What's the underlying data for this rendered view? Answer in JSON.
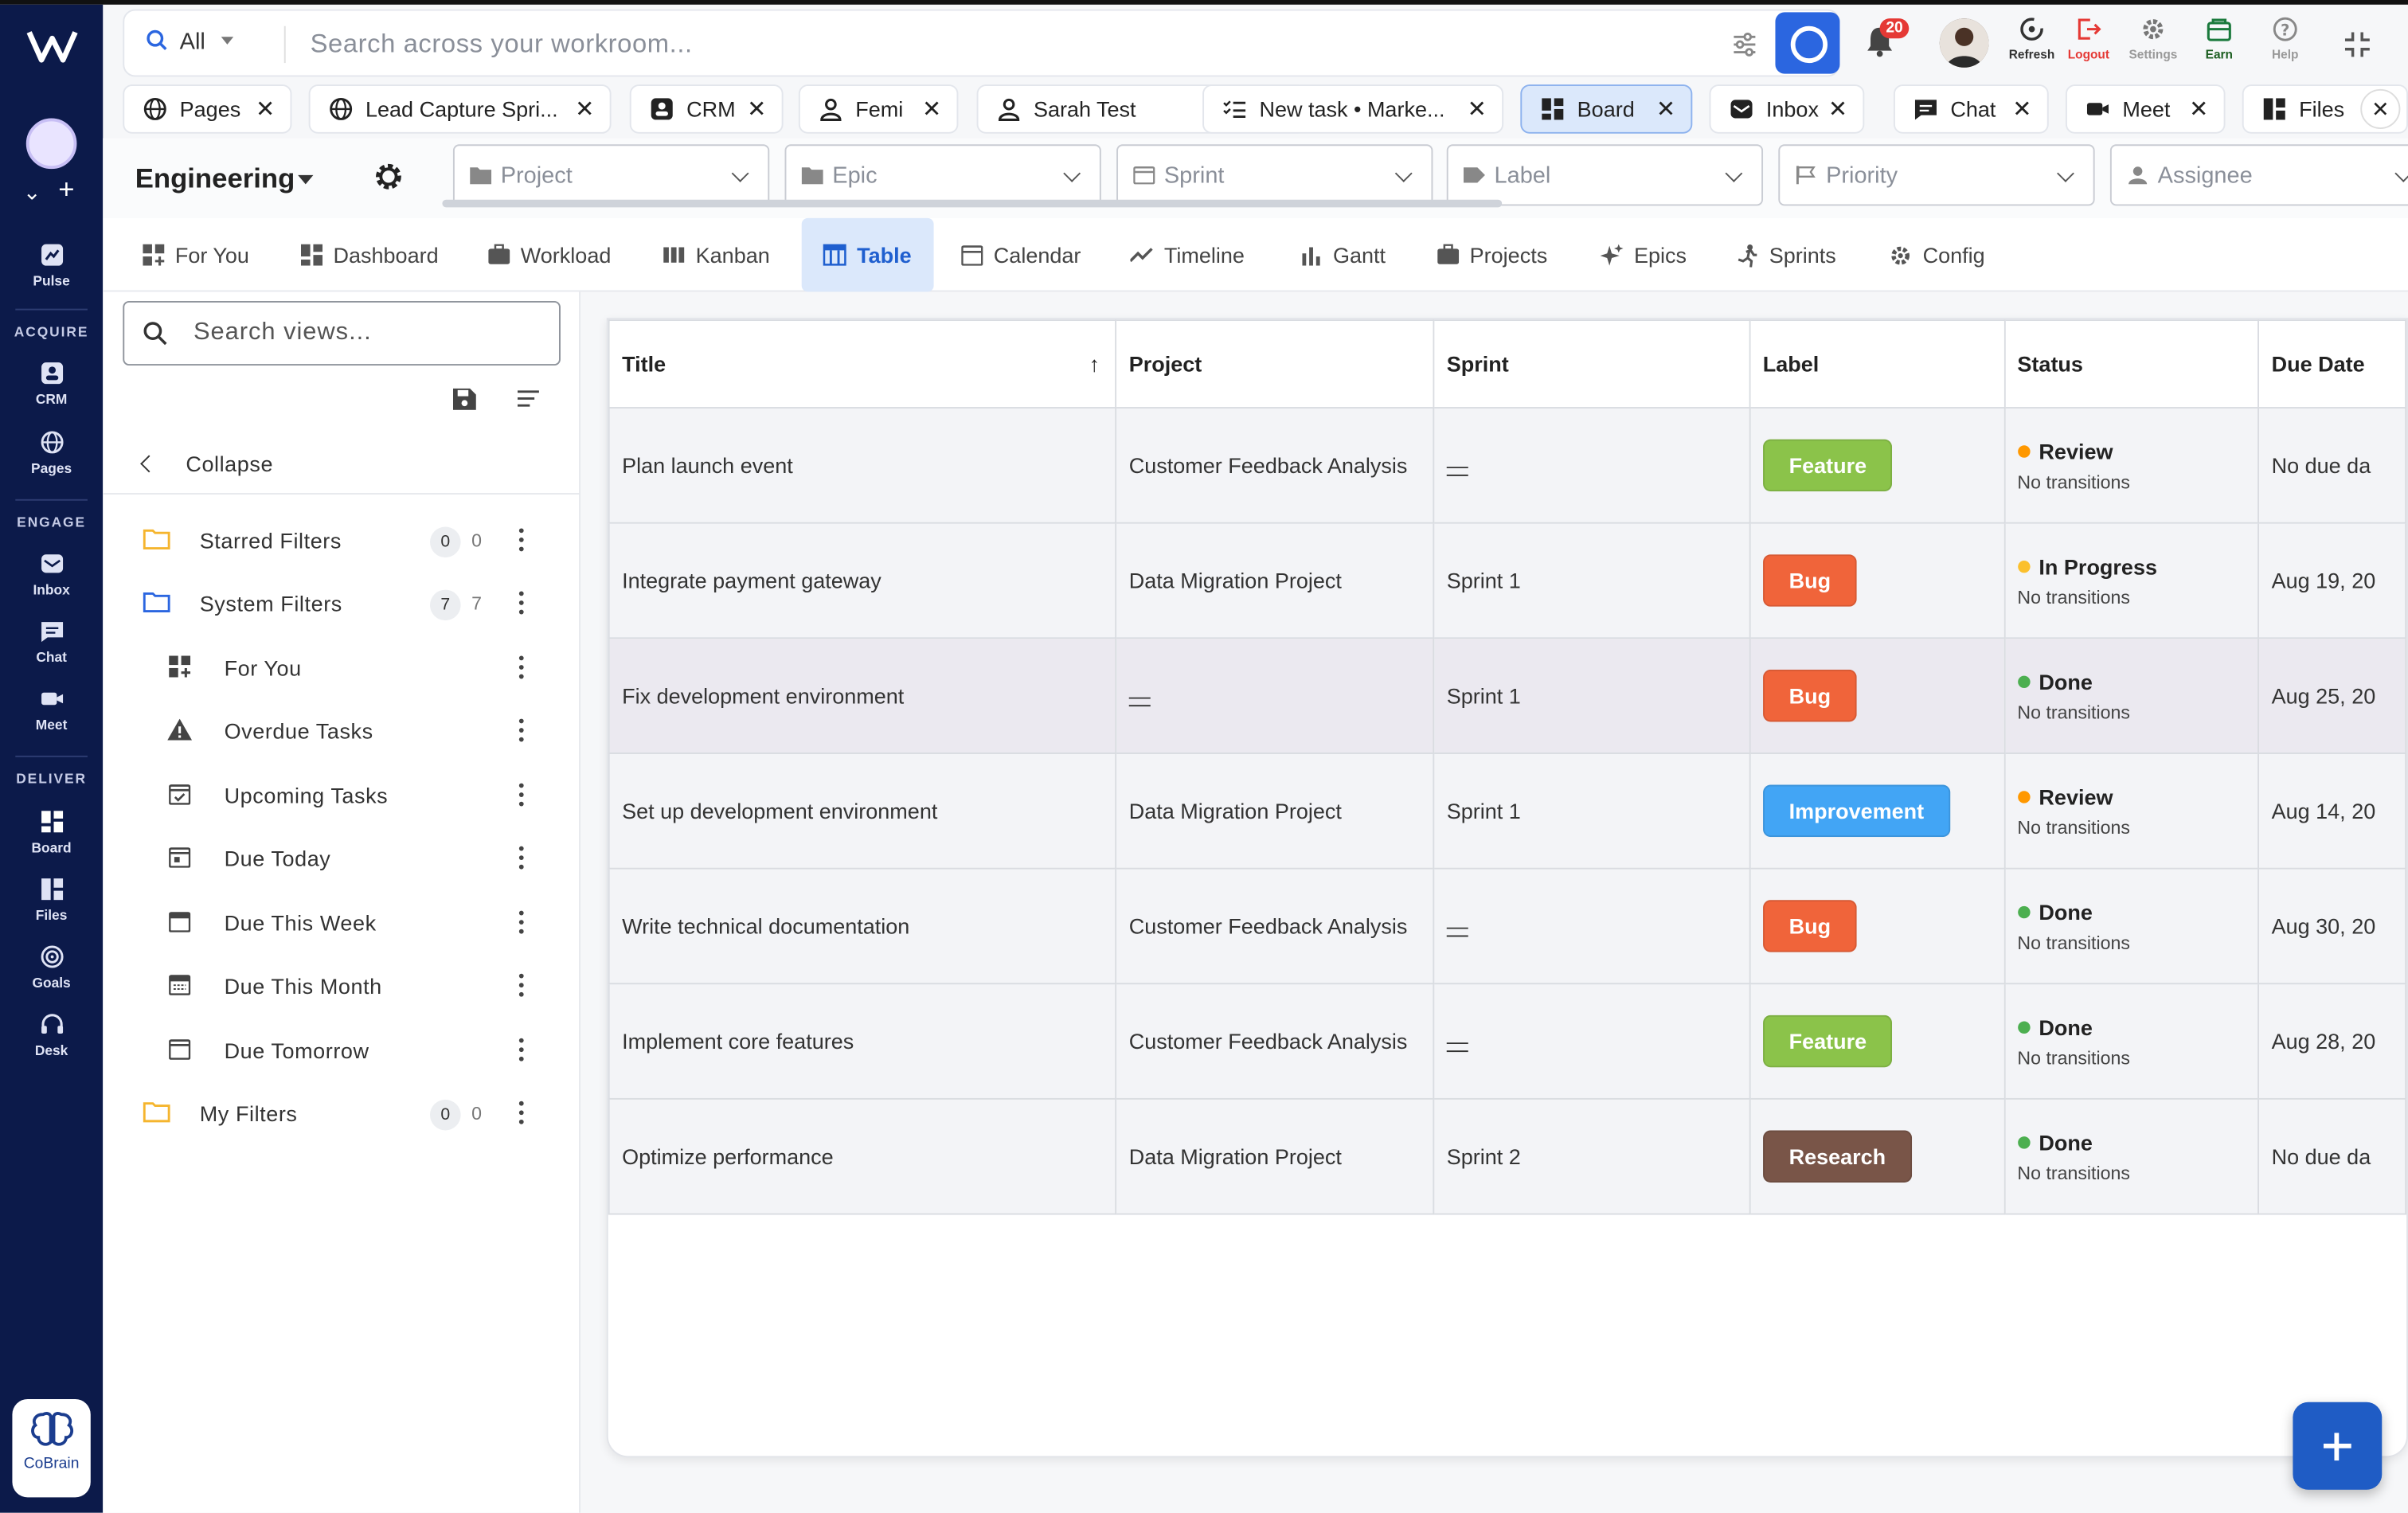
{
  "rail": {
    "items_top": [
      {
        "label": "Pulse"
      }
    ],
    "sections": [
      {
        "title": "ACQUIRE",
        "items": [
          {
            "label": "CRM"
          },
          {
            "label": "Pages"
          }
        ]
      },
      {
        "title": "ENGAGE",
        "items": [
          {
            "label": "Inbox"
          },
          {
            "label": "Chat"
          },
          {
            "label": "Meet"
          }
        ]
      },
      {
        "title": "DELIVER",
        "items": [
          {
            "label": "Board"
          },
          {
            "label": "Files"
          },
          {
            "label": "Goals"
          },
          {
            "label": "Desk"
          }
        ]
      }
    ],
    "cobrain": "CoBrain"
  },
  "search": {
    "scope": "All",
    "placeholder": "Search across your workroom..."
  },
  "toolbar": {
    "notif_count": "20",
    "refresh": "Refresh",
    "logout": "Logout",
    "settings": "Settings",
    "earn": "Earn",
    "help": "Help"
  },
  "tabs": [
    {
      "label": "Pages",
      "icon": "globe-icon"
    },
    {
      "label": "Lead Capture Spri...",
      "icon": "globe-icon"
    },
    {
      "label": "CRM",
      "icon": "crm-icon"
    },
    {
      "label": "Femi",
      "icon": "person-icon"
    },
    {
      "label": "Sarah Test",
      "icon": "person-icon"
    },
    {
      "label": "New task • Marke...",
      "icon": "checklist-icon"
    },
    {
      "label": "Board",
      "icon": "board-icon"
    },
    {
      "label": "Inbox",
      "icon": "inbox-icon"
    },
    {
      "label": "Chat",
      "icon": "chat-icon"
    },
    {
      "label": "Meet",
      "icon": "video-icon"
    },
    {
      "label": "Files",
      "icon": "files-icon"
    }
  ],
  "workspace": {
    "name": "Engineering"
  },
  "filters": [
    {
      "label": "Project"
    },
    {
      "label": "Epic"
    },
    {
      "label": "Sprint"
    },
    {
      "label": "Label"
    },
    {
      "label": "Priority"
    },
    {
      "label": "Assignee"
    }
  ],
  "nav": [
    {
      "label": "For You"
    },
    {
      "label": "Dashboard"
    },
    {
      "label": "Workload"
    },
    {
      "label": "Kanban"
    },
    {
      "label": "Table"
    },
    {
      "label": "Calendar"
    },
    {
      "label": "Timeline"
    },
    {
      "label": "Gantt"
    },
    {
      "label": "Projects"
    },
    {
      "label": "Epics"
    },
    {
      "label": "Sprints"
    },
    {
      "label": "Config"
    }
  ],
  "views": {
    "search_placeholder": "Search views...",
    "collapse": "Collapse",
    "groups": [
      {
        "label": "Starred Filters",
        "count": "0",
        "count2": "0"
      },
      {
        "label": "System Filters",
        "count": "7",
        "count2": "7"
      },
      {
        "label": "My Filters",
        "count": "0",
        "count2": "0"
      }
    ],
    "system_items": [
      {
        "label": "For You"
      },
      {
        "label": "Overdue Tasks"
      },
      {
        "label": "Upcoming Tasks"
      },
      {
        "label": "Due Today"
      },
      {
        "label": "Due This Week"
      },
      {
        "label": "Due This Month"
      },
      {
        "label": "Due Tomorrow"
      }
    ]
  },
  "table": {
    "columns": [
      "Title",
      "Project",
      "Sprint",
      "Label",
      "Status",
      "Due Date"
    ],
    "rows": [
      {
        "title": "Plan launch event",
        "project": "Customer Feedback Analysis",
        "sprint": "—",
        "label": "Feature",
        "label_color": "#8bc34a",
        "status": "Review",
        "status_color": "#ff9800",
        "sub": "No transitions",
        "due": "No due da"
      },
      {
        "title": "Integrate payment gateway",
        "project": "Data Migration Project",
        "sprint": "Sprint 1",
        "label": "Bug",
        "label_color": "#f0643a",
        "status": "In Progress",
        "status_color": "#fbc02d",
        "sub": "No transitions",
        "due": "Aug 19, 20"
      },
      {
        "title": "Fix development environment",
        "project": "—",
        "sprint": "Sprint 1",
        "label": "Bug",
        "label_color": "#f0643a",
        "status": "Done",
        "status_color": "#4caf50",
        "sub": "No transitions",
        "due": "Aug 25, 20"
      },
      {
        "title": "Set up development environment",
        "project": "Data Migration Project",
        "sprint": "Sprint 1",
        "label": "Improvement",
        "label_color": "#42a5f5",
        "status": "Review",
        "status_color": "#ff9800",
        "sub": "No transitions",
        "due": "Aug 14, 20"
      },
      {
        "title": "Write technical documentation",
        "project": "Customer Feedback Analysis",
        "sprint": "—",
        "label": "Bug",
        "label_color": "#f0643a",
        "status": "Done",
        "status_color": "#4caf50",
        "sub": "No transitions",
        "due": "Aug 30, 20"
      },
      {
        "title": "Implement core features",
        "project": "Customer Feedback Analysis",
        "sprint": "—",
        "label": "Feature",
        "label_color": "#8bc34a",
        "status": "Done",
        "status_color": "#4caf50",
        "sub": "No transitions",
        "due": "Aug 28, 20"
      },
      {
        "title": "Optimize performance",
        "project": "Data Migration Project",
        "sprint": "Sprint 2",
        "label": "Research",
        "label_color": "#795548",
        "status": "Done",
        "status_color": "#4caf50",
        "sub": "No transitions",
        "due": "No due da"
      }
    ]
  },
  "colors": {
    "rail": "#0c1a4a",
    "accent": "#2b66e0",
    "active_tab": "#dbe8fb"
  }
}
